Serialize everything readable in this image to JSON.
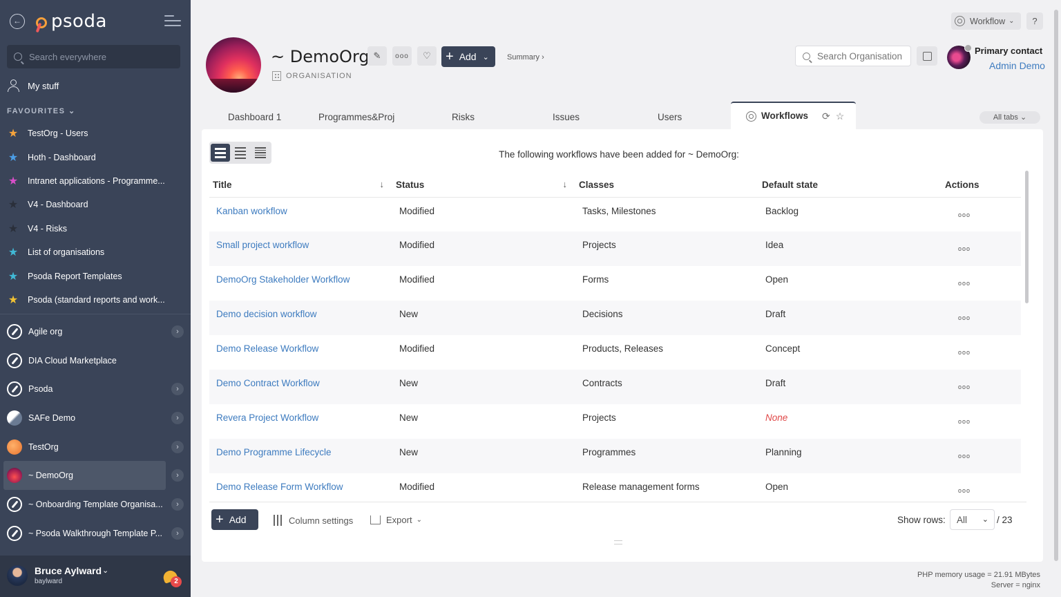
{
  "sidebar": {
    "logo_text": "psoda",
    "search_placeholder": "Search everywhere",
    "my_stuff": "My stuff",
    "favourites_header": "FAVOURITES ⌄",
    "favourites": [
      {
        "label": "TestOrg - Users",
        "star_color": "#f5a33c"
      },
      {
        "label": "Hoth - Dashboard",
        "star_color": "#4c9ee6"
      },
      {
        "label": "Intranet applications - Programme...",
        "star_color": "#d84fc9"
      },
      {
        "label": "V4 - Dashboard",
        "star_color": "#2a2f3a"
      },
      {
        "label": "V4 - Risks",
        "star_color": "#2a2f3a"
      },
      {
        "label": "List of organisations",
        "star_color": "#41b9d6"
      },
      {
        "label": "Psoda Report Templates",
        "star_color": "#41b9d6"
      },
      {
        "label": "Psoda (standard reports and work...",
        "star_color": "#f2c233"
      }
    ],
    "orgs": [
      {
        "label": "Agile org",
        "icon": "compass-icon",
        "chevron": true,
        "active": false
      },
      {
        "label": "DIA Cloud Marketplace",
        "icon": "compass-icon",
        "chevron": false,
        "active": false
      },
      {
        "label": "Psoda",
        "icon": "compass-icon",
        "chevron": true,
        "active": false
      },
      {
        "label": "SAFe Demo",
        "icon": "safe-icon",
        "chevron": true,
        "active": false
      },
      {
        "label": "TestOrg",
        "icon": "testorg-icon",
        "chevron": true,
        "active": false
      },
      {
        "label": "~ DemoOrg",
        "icon": "demoorg-icon",
        "chevron": true,
        "active": true
      },
      {
        "label": "~ Onboarding Template Organisa...",
        "icon": "compass-icon",
        "chevron": true,
        "active": false
      },
      {
        "label": "~ Psoda Walkthrough Template P...",
        "icon": "compass-icon",
        "chevron": true,
        "active": false
      }
    ],
    "user": {
      "name": "Bruce Aylward",
      "handle": "baylward",
      "notifications": "2"
    }
  },
  "header": {
    "title": "~ DemoOrg",
    "subtitle": "ORGANISATION",
    "add_label": "Add",
    "summary_label": "Summary ›",
    "workflow_menu": "Workflow",
    "help": "?",
    "search_placeholder": "Search Organisation",
    "primary_contact_label": "Primary contact",
    "primary_contact_name": "Admin Demo"
  },
  "tabs": {
    "items": [
      "Dashboard 1",
      "Programmes&Proj",
      "Risks",
      "Issues",
      "Users"
    ],
    "active": "Workflows",
    "all_tabs": "All tabs ⌄"
  },
  "main": {
    "caption": "The following workflows have been added for ~ DemoOrg:",
    "columns": [
      "Title",
      "Status",
      "Classes",
      "Default state",
      "Actions"
    ],
    "rows": [
      {
        "title": "Kanban workflow",
        "status": "Modified",
        "classes": "Tasks, Milestones",
        "default_state": "Backlog"
      },
      {
        "title": "Small project workflow",
        "status": "Modified",
        "classes": "Projects",
        "default_state": "Idea"
      },
      {
        "title": "DemoOrg Stakeholder Workflow",
        "status": "Modified",
        "classes": "Forms",
        "default_state": "Open"
      },
      {
        "title": "Demo decision workflow",
        "status": "New",
        "classes": "Decisions",
        "default_state": "Draft"
      },
      {
        "title": "Demo Release Workflow",
        "status": "Modified",
        "classes": "Products, Releases",
        "default_state": "Concept"
      },
      {
        "title": "Demo Contract Workflow",
        "status": "New",
        "classes": "Contracts",
        "default_state": "Draft"
      },
      {
        "title": "Revera Project Workflow",
        "status": "New",
        "classes": "Projects",
        "default_state": "None"
      },
      {
        "title": "Demo Programme Lifecycle",
        "status": "New",
        "classes": "Programmes",
        "default_state": "Planning"
      },
      {
        "title": "Demo Release Form Workflow",
        "status": "Modified",
        "classes": "Release management forms",
        "default_state": "Open"
      }
    ],
    "actions_glyph": "ooo",
    "footer": {
      "add_label": "Add",
      "column_settings": "Column settings",
      "export": "Export",
      "show_rows_label": "Show rows:",
      "show_rows_value": "All",
      "total": "/ 23"
    }
  },
  "footer": {
    "memory": "PHP memory usage = 21.91 MBytes",
    "server": "Server = nginx"
  },
  "colors": {
    "sidebar": "#3a4458",
    "link": "#3d7bbf",
    "none_state": "#e04848",
    "primary_button": "#3a4458"
  }
}
